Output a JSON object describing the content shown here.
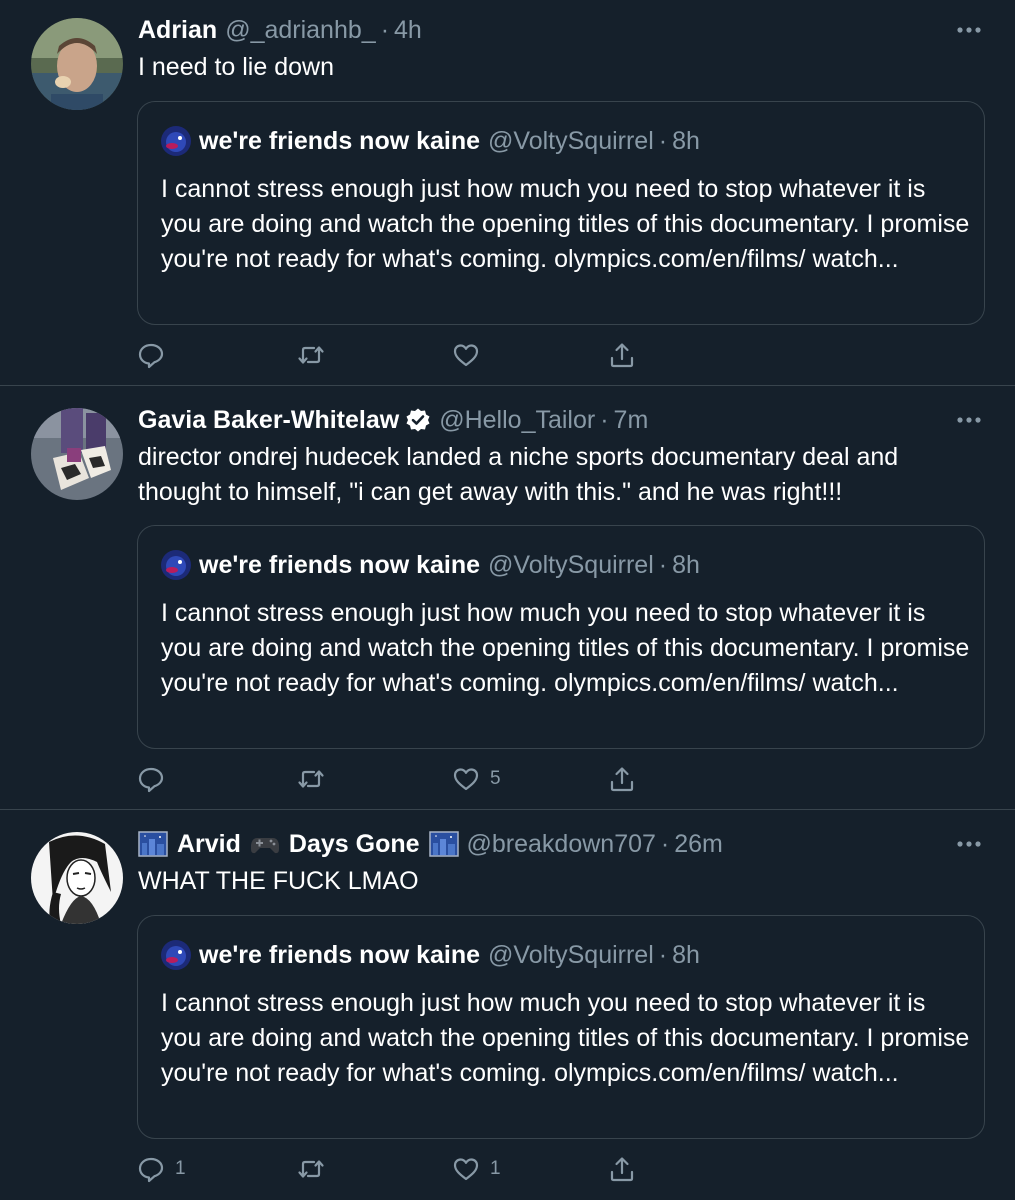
{
  "tweets": [
    {
      "name": "Adrian",
      "handle": "@_adrianhb_",
      "time": "4h",
      "verified": false,
      "text": "I need to lie down",
      "avatar_icon": "adrian-avatar",
      "quote": {
        "name": "we're friends now kaine",
        "handle": "@VoltySquirrel",
        "time": "8h",
        "text": "I cannot stress enough just how much you need to stop whatever it is you are doing and watch the opening titles of this documentary. I promise you're not ready for what's coming. olympics.com/en/films/ watch..."
      },
      "reply_count": "",
      "retweet_count": "",
      "like_count": ""
    },
    {
      "name": "Gavia Baker-Whitelaw",
      "handle": "@Hello_Tailor",
      "time": "7m",
      "verified": true,
      "text": "director ondrej hudecek landed a niche sports documentary deal and thought to himself, \"i can get away with this.\" and he was right!!!",
      "avatar_icon": "shoes-avatar",
      "quote": {
        "name": "we're friends now kaine",
        "handle": "@VoltySquirrel",
        "time": "8h",
        "text": "I cannot stress enough just how much you need to stop whatever it is you are doing and watch the opening titles of this documentary. I promise you're not ready for what's coming. olympics.com/en/films/ watch..."
      },
      "reply_count": "",
      "retweet_count": "",
      "like_count": "5"
    },
    {
      "name_parts": [
        "Arvid",
        "Days Gone"
      ],
      "name_emojis": [
        "night-city-emoji",
        "gamepad-emoji",
        "night-city-emoji"
      ],
      "handle": "@breakdown707",
      "time": "26m",
      "verified": false,
      "text": "WHAT THE FUCK LMAO",
      "avatar_icon": "sketch-portrait-avatar",
      "quote": {
        "name": "we're friends now kaine",
        "handle": "@VoltySquirrel",
        "time": "8h",
        "text": "I cannot stress enough just how much you need to stop whatever it is you are doing and watch the opening titles of this documentary. I promise you're not ready for what's coming. olympics.com/en/films/ watch..."
      },
      "reply_count": "1",
      "retweet_count": "",
      "like_count": "1"
    }
  ],
  "dot_separator": "·",
  "colors": {
    "background": "#15202b",
    "border": "#38444d",
    "secondary_text": "#8899a6",
    "verified_blue": "#ffffff"
  }
}
